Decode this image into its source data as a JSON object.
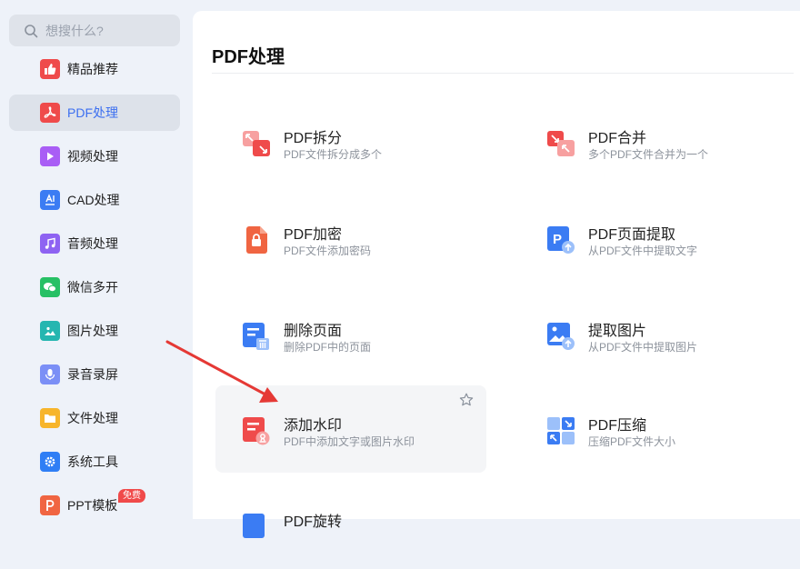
{
  "search": {
    "placeholder": "想搜什么?"
  },
  "sidebar": {
    "items": [
      {
        "label": "精品推荐",
        "icon": "thumbs-up-icon",
        "color": "#ef4b4b"
      },
      {
        "label": "PDF处理",
        "icon": "pdf-icon",
        "color": "#ef4b4b",
        "active": true
      },
      {
        "label": "视频处理",
        "icon": "play-icon",
        "color": "#a95ef5"
      },
      {
        "label": "CAD处理",
        "icon": "cad-icon",
        "color": "#3b7cf3"
      },
      {
        "label": "音频处理",
        "icon": "music-icon",
        "color": "#8e63f2"
      },
      {
        "label": "微信多开",
        "icon": "wechat-icon",
        "color": "#27c065"
      },
      {
        "label": "图片处理",
        "icon": "image-icon",
        "color": "#25b6b0"
      },
      {
        "label": "录音录屏",
        "icon": "microphone-icon",
        "color": "#7b8ff6"
      },
      {
        "label": "文件处理",
        "icon": "folder-icon",
        "color": "#f7b52c"
      },
      {
        "label": "系统工具",
        "icon": "gear-icon",
        "color": "#2f7ef5"
      },
      {
        "label": "PPT模板",
        "icon": "ppt-icon",
        "color": "#f06542",
        "badge": "免费"
      }
    ]
  },
  "main": {
    "title": "PDF处理",
    "tools": [
      {
        "name": "PDF拆分",
        "desc": "PDF文件拆分成多个",
        "icon": "split-icon"
      },
      {
        "name": "PDF合并",
        "desc": "多个PDF文件合并为一个",
        "icon": "merge-icon"
      },
      {
        "name": "PDF加密",
        "desc": "PDF文件添加密码",
        "icon": "lock-icon"
      },
      {
        "name": "PDF页面提取",
        "desc": "从PDF文件中提取文字",
        "icon": "page-extract-icon"
      },
      {
        "name": "删除页面",
        "desc": "删除PDF中的页面",
        "icon": "delete-page-icon"
      },
      {
        "name": "提取图片",
        "desc": "从PDF文件中提取图片",
        "icon": "extract-image-icon"
      },
      {
        "name": "添加水印",
        "desc": "PDF中添加文字或图片水印",
        "icon": "watermark-icon",
        "hover": true
      },
      {
        "name": "PDF压缩",
        "desc": "压缩PDF文件大小",
        "icon": "compress-icon"
      },
      {
        "name": "PDF旋转",
        "desc": "",
        "icon": "rotate-icon"
      }
    ]
  },
  "colors": {
    "accent": "#3c6ff0",
    "red": "#ef4b4b",
    "arrow": "#e53935"
  }
}
